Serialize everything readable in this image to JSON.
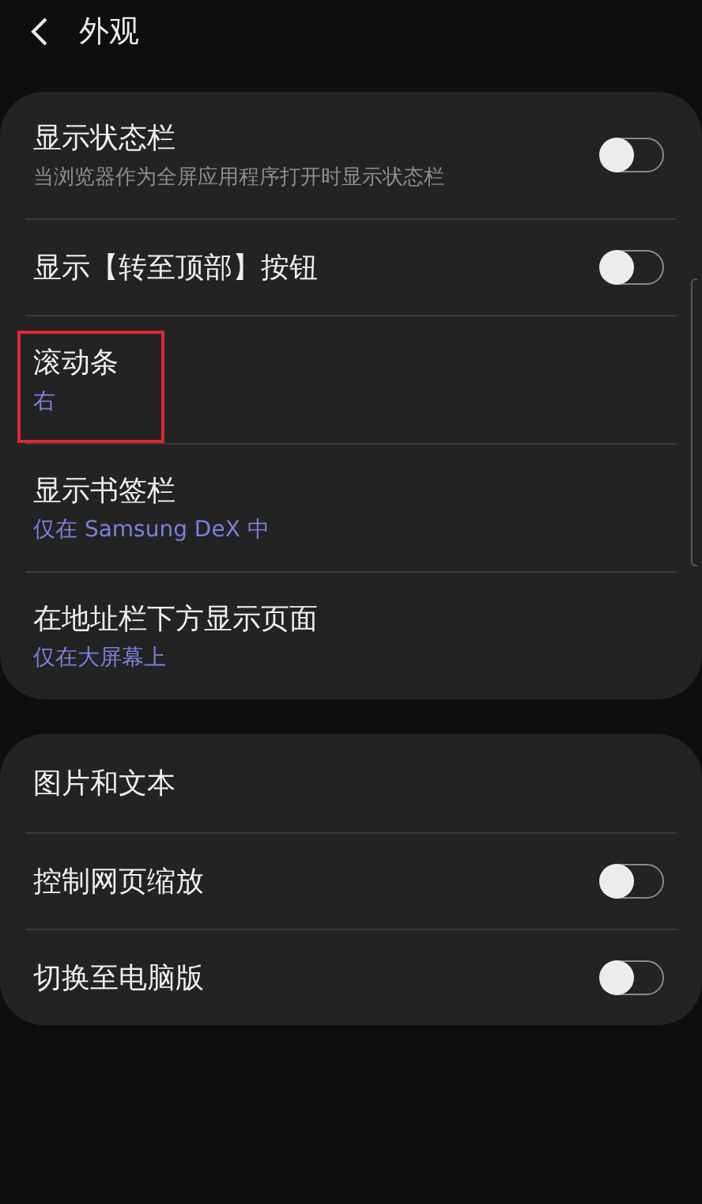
{
  "header": {
    "title": "外观"
  },
  "groups": [
    {
      "rows": [
        {
          "kind": "toggle",
          "title": "显示状态栏",
          "subtitle": "当浏览器作为全屏应用程序打开时显示状态栏",
          "on": false,
          "highlighted": false
        },
        {
          "kind": "toggle",
          "title": "显示【转至顶部】按钮",
          "on": false,
          "highlighted": false
        },
        {
          "kind": "value",
          "title": "滚动条",
          "value": "右",
          "highlighted": true
        },
        {
          "kind": "value",
          "title": "显示书签栏",
          "value": "仅在 Samsung DeX 中",
          "highlighted": false
        },
        {
          "kind": "value",
          "title": "在地址栏下方显示页面",
          "value": "仅在大屏幕上",
          "highlighted": false
        }
      ]
    },
    {
      "rows": [
        {
          "kind": "plain",
          "title": "图片和文本",
          "highlighted": false
        },
        {
          "kind": "toggle",
          "title": "控制网页缩放",
          "on": false,
          "highlighted": false
        },
        {
          "kind": "toggle",
          "title": "切换至电脑版",
          "on": false,
          "highlighted": false
        }
      ]
    }
  ]
}
